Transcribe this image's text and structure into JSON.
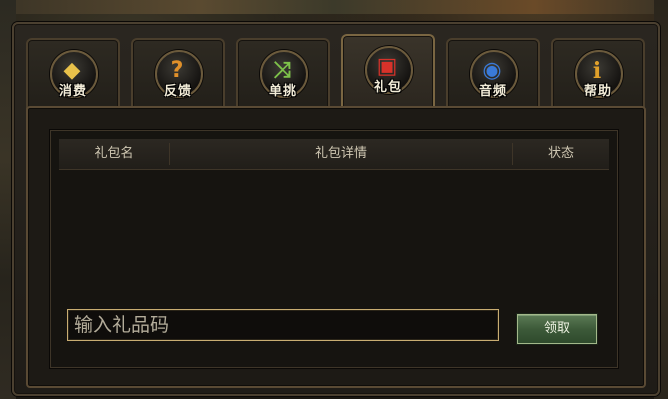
{
  "tabs": [
    {
      "label": "消费",
      "icon": "gold-ingot-icon",
      "glyph": "◆",
      "color": "#e8c14a",
      "active": false
    },
    {
      "label": "反馈",
      "icon": "question-mark-icon",
      "glyph": "?",
      "color": "#e0902a",
      "active": false
    },
    {
      "label": "单挑",
      "icon": "crossed-arrows-icon",
      "glyph": "⤨",
      "color": "#7ec24a",
      "active": false
    },
    {
      "label": "礼包",
      "icon": "gift-box-icon",
      "glyph": "▣",
      "color": "#d8322a",
      "active": true
    },
    {
      "label": "音频",
      "icon": "speaker-icon",
      "glyph": "◉",
      "color": "#3a7ad8",
      "active": false
    },
    {
      "label": "帮助",
      "icon": "info-icon",
      "glyph": "i",
      "color": "#e0a02a",
      "active": false
    }
  ],
  "gift_panel": {
    "columns": [
      "礼包名",
      "礼包详情",
      "状态"
    ],
    "rows": [],
    "code_input_placeholder": "输入礼品码",
    "code_input_value": "",
    "claim_button_label": "领取"
  }
}
